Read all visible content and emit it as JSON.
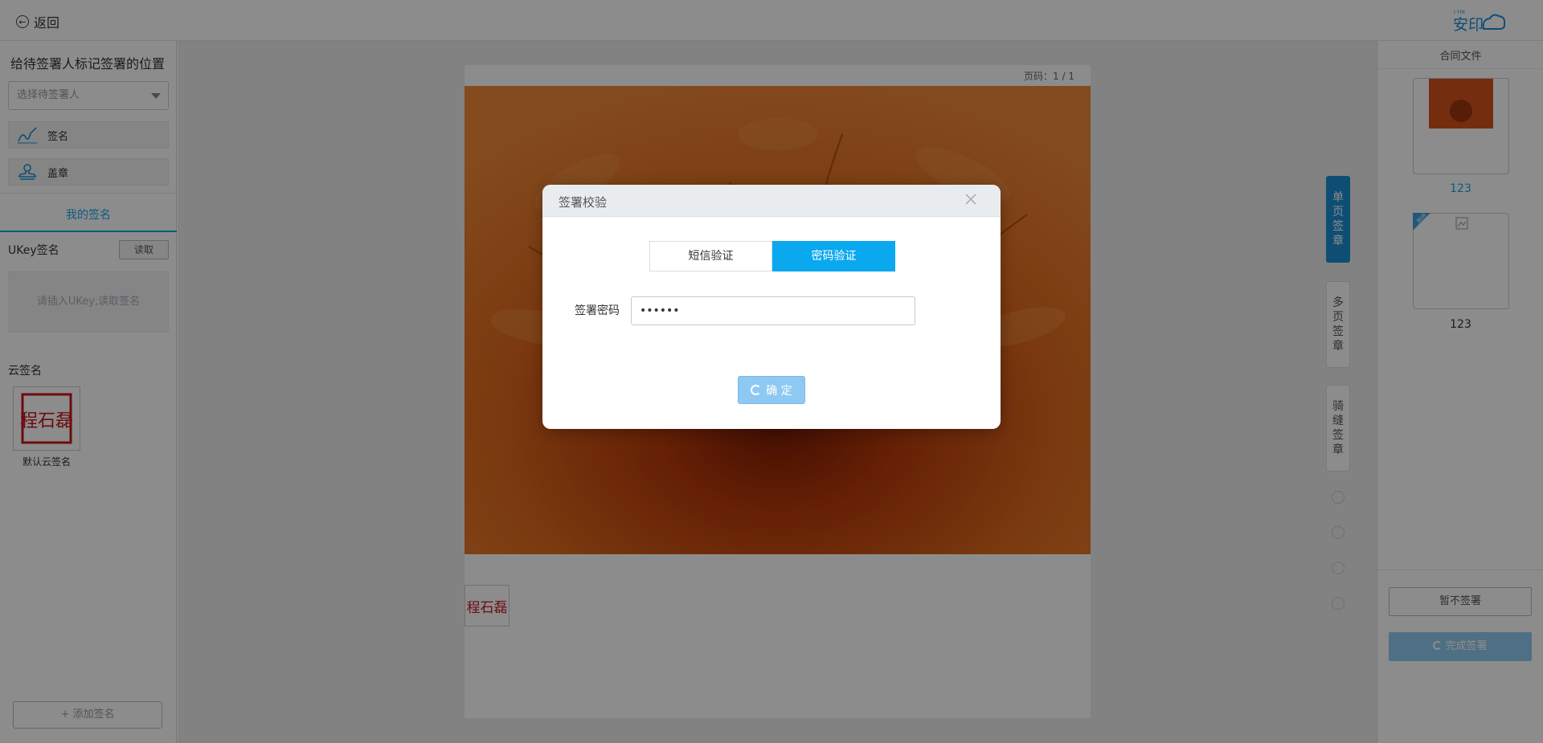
{
  "header": {
    "back_label": "返回",
    "logo_text": "安印",
    "logo_sub": "I·YIN"
  },
  "left": {
    "title": "给待签署人标记签署的位置",
    "signer_placeholder": "选择待签署人",
    "tools": [
      {
        "label": "签名",
        "icon": "pen-sign-icon"
      },
      {
        "label": "盖章",
        "icon": "stamp-icon"
      }
    ],
    "tab_label": "我的签名",
    "ukey_label": "UKey签名",
    "read_button": "读取",
    "ukey_hint": "请插入UKey,读取签名",
    "cloud_label": "云签名",
    "seal_text": "程石磊",
    "seal_name": "默认云签名",
    "add_button": "+ 添加签名"
  },
  "document": {
    "page_indicator": "页码：1 / 1"
  },
  "side_tabs": [
    {
      "label": "单页签章",
      "active": true
    },
    {
      "label": "多页签章",
      "active": false
    },
    {
      "label": "骑缝签章",
      "active": false
    }
  ],
  "right": {
    "title": "合同文件",
    "files": [
      {
        "name": "123",
        "active": true
      },
      {
        "name": "123",
        "active": false,
        "badge": "附件"
      }
    ],
    "pause_button": "暂不签署",
    "finish_button": "完成签署"
  },
  "modal": {
    "title": "签署校验",
    "tabs": [
      {
        "label": "短信验证",
        "active": false
      },
      {
        "label": "密码验证",
        "active": true
      }
    ],
    "password_label": "签署密码",
    "password_value": "123456",
    "confirm_button": "确 定"
  },
  "colors": {
    "accent": "#0aa8ef",
    "primary": "#1a8fd6",
    "disabled_button": "#8ec9f3",
    "overlay": "rgba(0,0,0,0.45)"
  }
}
